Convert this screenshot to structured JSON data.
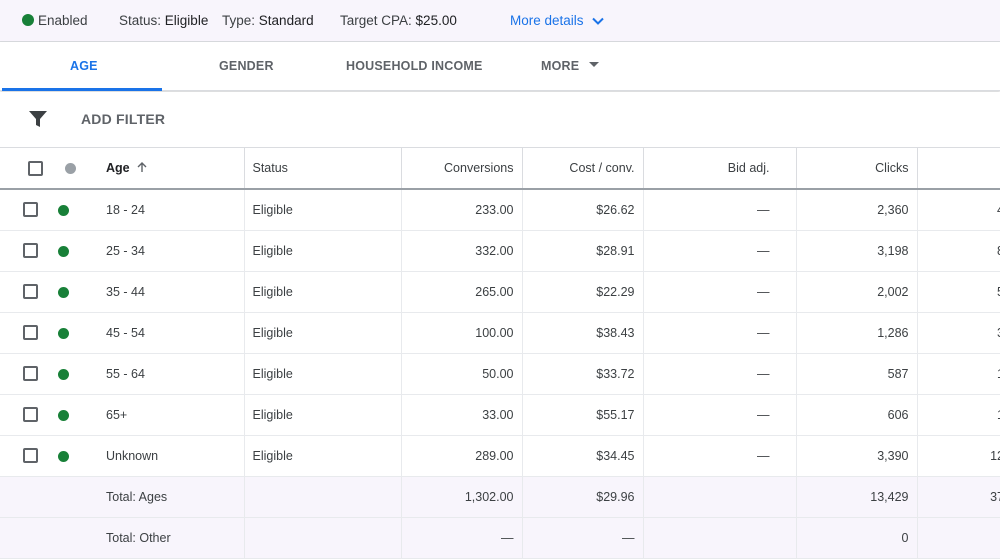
{
  "status_bar": {
    "enabled_label": "Enabled",
    "status_label": "Status:",
    "status_value": "Eligible",
    "type_label": "Type:",
    "type_value": "Standard",
    "target_cpa_label": "Target CPA:",
    "target_cpa_value": "$25.00",
    "more_details_label": "More details"
  },
  "tabs": [
    {
      "label": "AGE",
      "active": true
    },
    {
      "label": "GENDER",
      "active": false
    },
    {
      "label": "HOUSEHOLD INCOME",
      "active": false
    },
    {
      "label": "MORE",
      "active": false
    }
  ],
  "filter": {
    "add_filter_label": "ADD FILTER"
  },
  "table": {
    "headers": {
      "age": "Age",
      "status": "Status",
      "conversions": "Conversions",
      "cost_conv": "Cost / conv.",
      "bid_adj": "Bid adj.",
      "clicks": "Clicks"
    },
    "rows": [
      {
        "age": "18 - 24",
        "status": "Eligible",
        "conversions": "233.00",
        "cost_conv": "$26.62",
        "bid_adj": "—",
        "clicks": "2,360",
        "extra": "4"
      },
      {
        "age": "25 - 34",
        "status": "Eligible",
        "conversions": "332.00",
        "cost_conv": "$28.91",
        "bid_adj": "—",
        "clicks": "3,198",
        "extra": "8"
      },
      {
        "age": "35 - 44",
        "status": "Eligible",
        "conversions": "265.00",
        "cost_conv": "$22.29",
        "bid_adj": "—",
        "clicks": "2,002",
        "extra": "5"
      },
      {
        "age": "45 - 54",
        "status": "Eligible",
        "conversions": "100.00",
        "cost_conv": "$38.43",
        "bid_adj": "—",
        "clicks": "1,286",
        "extra": "3"
      },
      {
        "age": "55 - 64",
        "status": "Eligible",
        "conversions": "50.00",
        "cost_conv": "$33.72",
        "bid_adj": "—",
        "clicks": "587",
        "extra": "1"
      },
      {
        "age": "65+",
        "status": "Eligible",
        "conversions": "33.00",
        "cost_conv": "$55.17",
        "bid_adj": "—",
        "clicks": "606",
        "extra": "1"
      },
      {
        "age": "Unknown",
        "status": "Eligible",
        "conversions": "289.00",
        "cost_conv": "$34.45",
        "bid_adj": "—",
        "clicks": "3,390",
        "extra": "12"
      }
    ],
    "totals": [
      {
        "label": "Total: Ages",
        "conversions": "1,302.00",
        "cost_conv": "$29.96",
        "bid_adj": "",
        "clicks": "13,429",
        "extra": "37"
      },
      {
        "label": "Total: Other",
        "conversions": "—",
        "cost_conv": "—",
        "bid_adj": "",
        "clicks": "0",
        "extra": ""
      }
    ]
  },
  "colors": {
    "accent": "#1a73e8",
    "enabled_green": "#188038",
    "status_bar_bg": "#f8f5fc"
  },
  "icons": [
    "status-dot-icon",
    "chevron-down-icon",
    "caret-down-icon",
    "filter-icon",
    "checkbox-icon",
    "sort-up-arrow-icon"
  ]
}
